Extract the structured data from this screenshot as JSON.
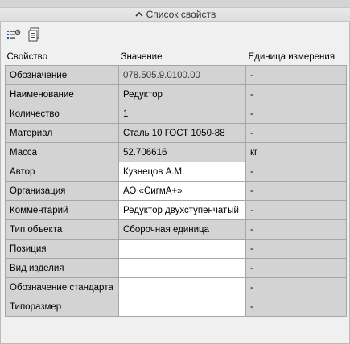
{
  "panel": {
    "title": "Список свойств"
  },
  "toolbar": {
    "btn1_icon": "list-settings-icon",
    "btn2_icon": "copy-document-icon"
  },
  "table": {
    "headers": [
      "Свойство",
      "Значение",
      "Единица измерения"
    ],
    "rows": [
      {
        "name": "Обозначение",
        "value": "078.505.9.0100.00",
        "unit": "-",
        "editable": false
      },
      {
        "name": "Наименование",
        "value": "Редуктор",
        "unit": "-",
        "editable": false
      },
      {
        "name": "Количество",
        "value": "1",
        "unit": "-",
        "editable": false
      },
      {
        "name": "Материал",
        "value": "Сталь 10  ГОСТ 1050-88",
        "unit": "-",
        "editable": false
      },
      {
        "name": "Масса",
        "value": "52.706616",
        "unit": "кг",
        "editable": false
      },
      {
        "name": "Автор",
        "value": "Кузнецов А.М.",
        "unit": "-",
        "editable": true
      },
      {
        "name": "Организация",
        "value": "АО «СигмА+»",
        "unit": "-",
        "editable": true
      },
      {
        "name": "Комментарий",
        "value": "Редуктор двухступенчатый",
        "unit": "-",
        "editable": true
      },
      {
        "name": "Тип объекта",
        "value": "Сборочная единица",
        "unit": "-",
        "editable": false
      },
      {
        "name": "Позиция",
        "value": "",
        "unit": "-",
        "editable": true
      },
      {
        "name": "Вид изделия",
        "value": "",
        "unit": "-",
        "editable": true
      },
      {
        "name": "Обозначение стандарта",
        "value": "",
        "unit": "-",
        "editable": true
      },
      {
        "name": "Типоразмер",
        "value": "",
        "unit": "-",
        "editable": true
      }
    ]
  }
}
